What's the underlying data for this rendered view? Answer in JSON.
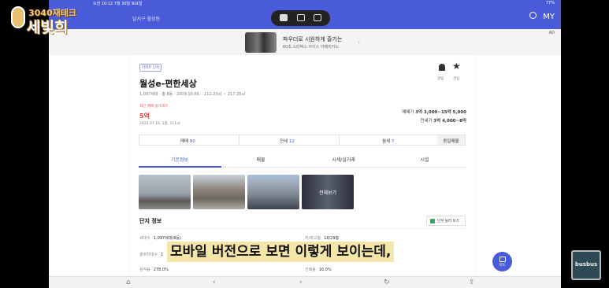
{
  "status_bar": {
    "time": "오전 10:12 7월 30일 토요일",
    "battery": "77%"
  },
  "channel_logo": {
    "line1": "3040재테크",
    "line2": "세빛희"
  },
  "header": {
    "crumb": "달서구 월성동",
    "right_label": "MY",
    "icons": [
      "search-icon"
    ]
  },
  "multitask_icons": [
    "fullscreen-icon",
    "split-view-icon",
    "slide-over-icon"
  ],
  "ad": {
    "line1": "파우더로 시원하게 즐기는",
    "line2": "60초 스타벅스 아이스 아메리카노",
    "badge": "AD"
  },
  "listing": {
    "tag": "아파트 단지",
    "name": "월성e-편한세상",
    "meta": "1,097세대 · 총 8동 · 2009.10.06. · 111.23㎡ ~ 217.35㎡",
    "bell_label": "알림",
    "star_label": "관심",
    "recent_label": "최근 매매 실거래가",
    "recent_price": "5억",
    "recent_date": "2022.07.10, 1층, 111㎡",
    "sale_range_label": "매매가",
    "sale_range": "3억 3,000~15억 5,000",
    "jeonse_range_label": "전세가",
    "jeonse_range": "3억 4,000~8억"
  },
  "deals": [
    {
      "label": "매매",
      "count": "80"
    },
    {
      "label": "전세",
      "count": "12"
    },
    {
      "label": "월세",
      "count": "7"
    }
  ],
  "deal_button": "동일매물",
  "tabs": [
    "기본정보",
    "매물",
    "시세/실거래",
    "시설"
  ],
  "photos": {
    "more_label": "전체보기"
  },
  "complex": {
    "title": "단지 정보",
    "map_button": "단지 둘러 보기",
    "rows": [
      {
        "k": "세대수",
        "v": "1,097세대(8동)"
      },
      {
        "k": "저/최고층",
        "v": "18/29층"
      },
      {
        "k": "총주차대수",
        "v": "1"
      },
      {
        "k": "용적률",
        "v": "278.0%"
      },
      {
        "k": "건폐율",
        "v": "16.0%"
      }
    ]
  },
  "fab_label": "지도",
  "bottom_nav": [
    "home-icon",
    "back-icon",
    "forward-icon",
    "reload-icon",
    "share-icon"
  ],
  "subtitle": "모바일 버전으로 보면 이렇게 보이는데,",
  "watermark": "busbus"
}
